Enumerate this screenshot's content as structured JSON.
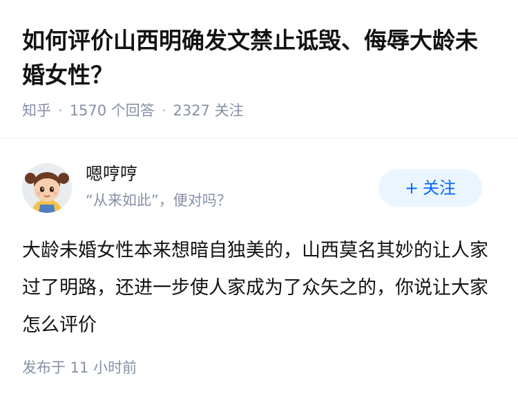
{
  "question": {
    "title": "如何评价山西明确发文禁止诋毁、侮辱大龄未婚女性？",
    "source": "知乎",
    "answer_count": "1570 个回答",
    "follower_count": "2327 关注"
  },
  "author": {
    "name": "嗯哼哼",
    "bio": "“从来如此”，便对吗？",
    "avatar_icon": "cartoon-girl-avatar",
    "follow_label": "关注",
    "follow_icon": "plus-icon"
  },
  "answer": {
    "content": "大龄未婚女性本来想暗自独美的，山西莫名其妙的让人家过了明路，还进一步使人家成为了众矢之的，你说让大家怎么评价",
    "published": "发布于 11 小时前"
  },
  "colors": {
    "primary": "#0066ff",
    "follow_bg": "#ebf5ff",
    "meta": "#8590a6",
    "text": "#121212"
  }
}
